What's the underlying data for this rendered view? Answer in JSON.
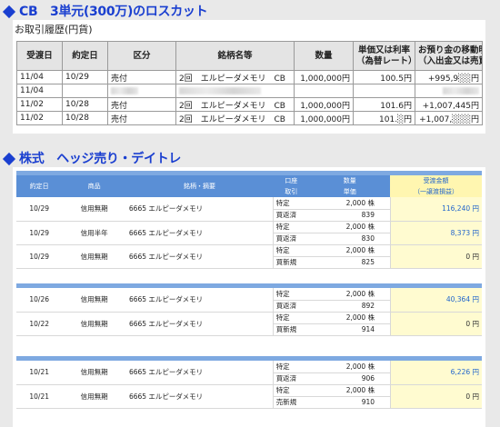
{
  "cb_heading": "CB　3単元(300万)のロスカット",
  "cb_caption": "お取引履歴(円貨)",
  "cb_columns": [
    "受渡日",
    "約定日",
    "区分",
    "銘柄名等",
    "数量",
    "単価又は利率\n（為替レート）",
    "お預り金の移動明細\n（入出金又は売買代金等）"
  ],
  "cb_rows": [
    {
      "settle": "11/04",
      "trade": "10/29",
      "type": "売付",
      "name": "2回　エルピーダメモリ　CB",
      "qty": "1,000,000円",
      "price": "100.5円",
      "amount": "+995,9░░円"
    },
    {
      "settle": "11/04",
      "trade": "",
      "type": "",
      "name": "",
      "qty": "",
      "price": "",
      "amount": ""
    },
    {
      "settle": "11/02",
      "trade": "10/28",
      "type": "売付",
      "name": "2回　エルピーダメモリ　CB",
      "qty": "1,000,000円",
      "price": "101.6円",
      "amount": "+1,007,445円"
    },
    {
      "settle": "11/02",
      "trade": "10/28",
      "type": "売付",
      "name": "2回　エルピーダメモリ　CB",
      "qty": "1,000,000円",
      "price": "101.░円",
      "amount": "+1,007,░░░円"
    }
  ],
  "stock_heading": "株式　ヘッジ売り・デイトレ",
  "stock_columns": {
    "date": "約定日",
    "product": "商品",
    "name": "銘柄・摘要",
    "acct_top": "口座",
    "acct_bottom": "取引",
    "qty_top": "数量",
    "qty_bottom": "単価",
    "pl_top": "受渡金額",
    "pl_bottom": "（一譲渡損益）"
  },
  "stock_groups": [
    {
      "entries": [
        {
          "date": "10/29",
          "product": "信用無期",
          "name": "6665 エルピーダメモリ",
          "acct": "特定",
          "side": "買返済",
          "qty": "2,000 株",
          "price": "839",
          "pl": "116,240 円",
          "pl_blue": true
        },
        {
          "date": "10/29",
          "product": "信用半年",
          "name": "6665 エルピーダメモリ",
          "acct": "特定",
          "side": "買返済",
          "qty": "2,000 株",
          "price": "830",
          "pl": "8,373 円",
          "pl_blue": true
        },
        {
          "date": "10/29",
          "product": "信用無期",
          "name": "6665 エルピーダメモリ",
          "acct": "特定",
          "side": "買新規",
          "qty": "2,000 株",
          "price": "825",
          "pl": "0 円",
          "pl_blue": false
        }
      ]
    },
    {
      "entries": [
        {
          "date": "10/26",
          "product": "信用無期",
          "name": "6665 エルピーダメモリ",
          "acct": "特定",
          "side": "買返済",
          "qty": "2,000 株",
          "price": "892",
          "pl": "40,364 円",
          "pl_blue": true
        },
        {
          "date": "10/22",
          "product": "信用無期",
          "name": "6665 エルピーダメモリ",
          "acct": "特定",
          "side": "買新規",
          "qty": "2,000 株",
          "price": "914",
          "pl": "0 円",
          "pl_blue": false
        }
      ]
    },
    {
      "entries": [
        {
          "date": "10/21",
          "product": "信用無期",
          "name": "6665 エルピーダメモリ",
          "acct": "特定",
          "side": "買返済",
          "qty": "2,000 株",
          "price": "906",
          "pl": "6,226 円",
          "pl_blue": true
        },
        {
          "date": "10/21",
          "product": "信用無期",
          "name": "6665 エルピーダメモリ",
          "acct": "特定",
          "side": "売新規",
          "qty": "2,000 株",
          "price": "910",
          "pl": "0 円",
          "pl_blue": false
        }
      ]
    }
  ],
  "colors": {
    "heading": "#1a3fd0",
    "header_blue": "#5a8fd6",
    "pl_yellow": "#fffbd0",
    "pl_text": "#2266cc"
  }
}
